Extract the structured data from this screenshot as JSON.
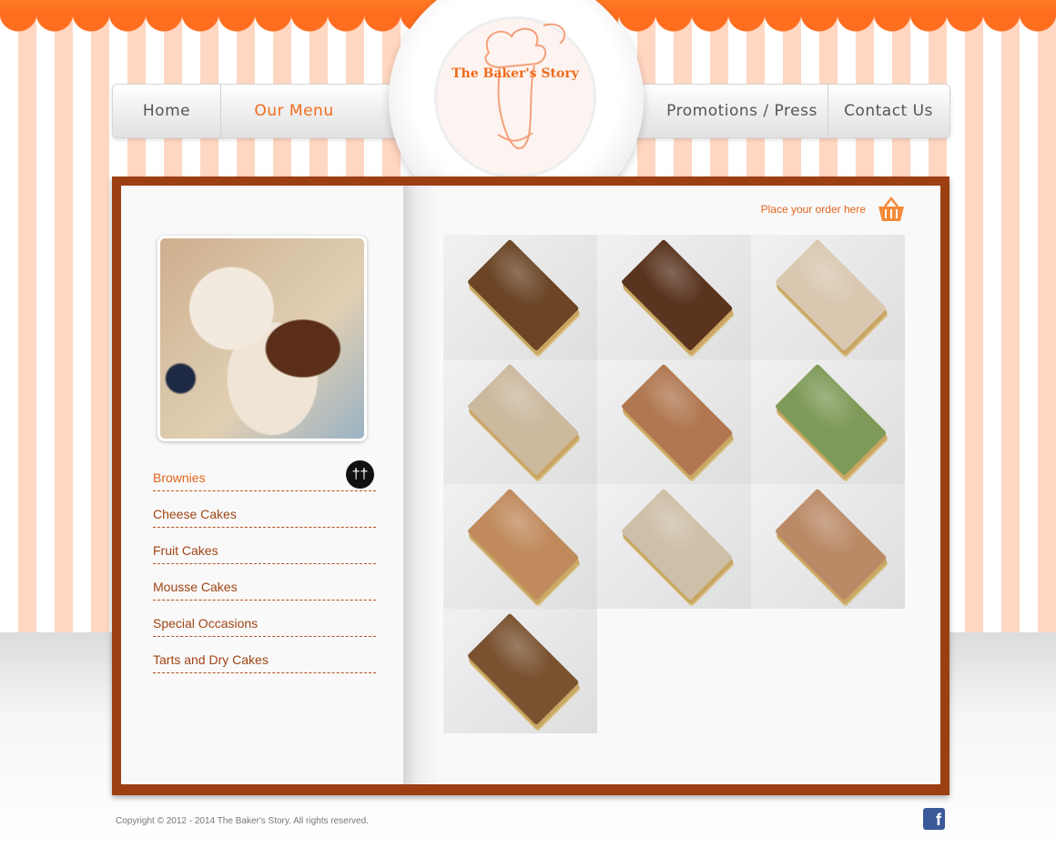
{
  "nav": {
    "home": "Home",
    "menu": "Our Menu",
    "promotions": "Promotions / Press",
    "contact": "Contact Us"
  },
  "logo": {
    "text": "The Baker's Story"
  },
  "order": {
    "label": "Place your order here"
  },
  "categories": [
    {
      "label": "Brownies",
      "active": true
    },
    {
      "label": "Cheese Cakes"
    },
    {
      "label": "Fruit Cakes"
    },
    {
      "label": "Mousse Cakes"
    },
    {
      "label": "Special Occasions"
    },
    {
      "label": "Tarts and Dry Cakes"
    }
  ],
  "products": [
    {
      "color": "#6b4526"
    },
    {
      "color": "#5a341f"
    },
    {
      "color": "#d9c7b0"
    },
    {
      "color": "#cbb89d"
    },
    {
      "color": "#b07750"
    },
    {
      "color": "#7f9a58"
    },
    {
      "color": "#c08a5c"
    },
    {
      "color": "#cdbfa8"
    },
    {
      "color": "#ba8a66"
    },
    {
      "color": "#7a5230"
    }
  ],
  "footer": {
    "copyright": "Copyright © 2012 - 2014 The Baker's Story. All rights reserved."
  },
  "colors": {
    "accent": "#f26a1b",
    "frame": "#9c3f12",
    "stripe": "#ffd7c2"
  }
}
